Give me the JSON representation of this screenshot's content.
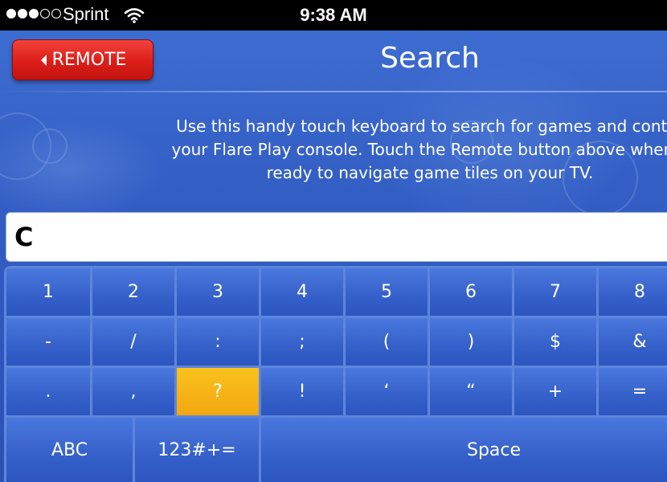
{
  "status_bar": {
    "carrier": "Sprint",
    "time": "9:38 AM",
    "signal_bars_filled": 3,
    "signal_bars_total": 5
  },
  "header": {
    "remote_label": "REMOTE",
    "title": "Search"
  },
  "instructions": "Use this handy touch keyboard to search for games and conter\nyour Flare Play console. Touch the Remote button above when y\nready to navigate game tiles on your TV.",
  "search": {
    "value": "C"
  },
  "keyboard": {
    "row1": [
      "1",
      "2",
      "3",
      "4",
      "5",
      "6",
      "7",
      "8"
    ],
    "row2": [
      "-",
      "/",
      ":",
      ";",
      "(",
      ")",
      "$",
      "&"
    ],
    "row3": [
      ".",
      ",",
      "?",
      "!",
      "‘",
      "“",
      "+",
      "="
    ],
    "bottom": {
      "abc": "ABC",
      "symbols": "123#+=",
      "space": "Space"
    },
    "active_key": "?"
  },
  "colors": {
    "accent_red": "#dd1d18",
    "highlight_yellow": "#f6b417",
    "background_blue": "#335ec4"
  }
}
